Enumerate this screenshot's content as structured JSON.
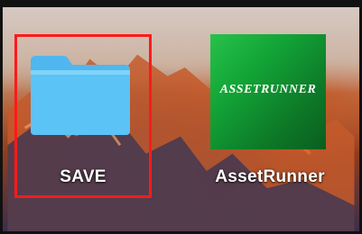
{
  "desktop": {
    "items": [
      {
        "name": "SAVE",
        "kind": "folder",
        "selected": true
      },
      {
        "name": "AssetRunner",
        "kind": "application",
        "icon_text": "ASSETRUNNER"
      }
    ]
  },
  "colors": {
    "selection": "#ff1a1a",
    "folder": "#5bc3f5",
    "app_icon": "#12a336"
  }
}
